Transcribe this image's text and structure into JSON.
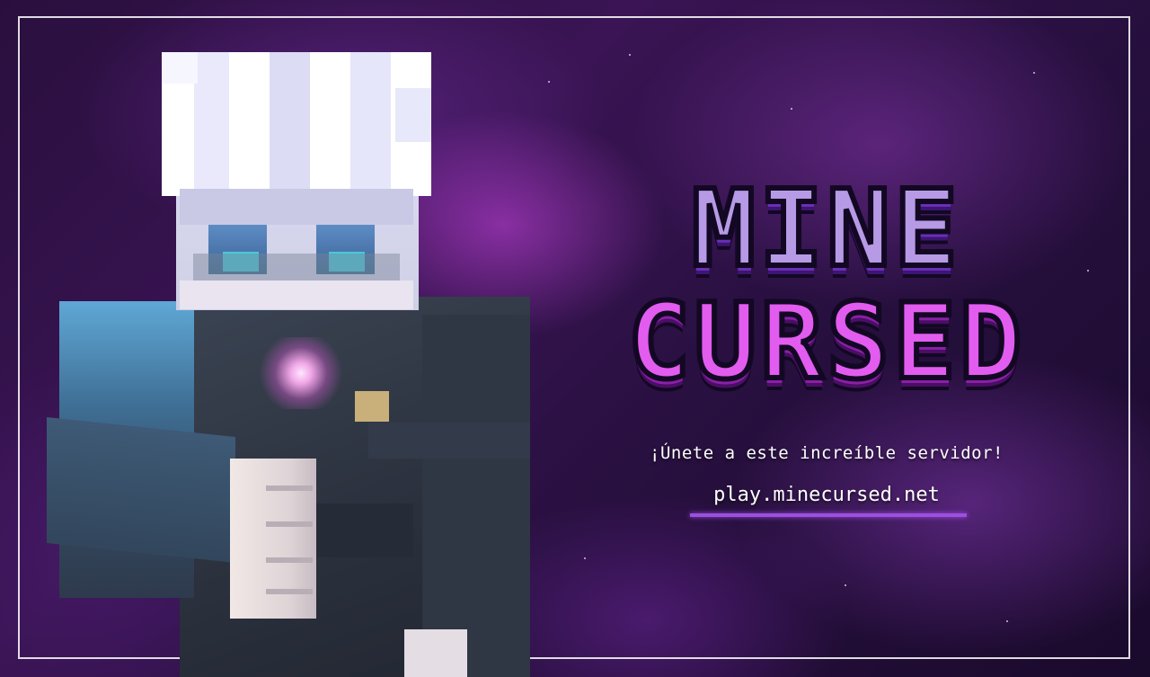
{
  "banner": {
    "logo": {
      "line1": "MINE",
      "line2": "CURSED"
    },
    "tagline": "¡Únete a este increíble servidor!",
    "server_ip": "play.minecursed.net"
  },
  "colors": {
    "background": "#2a0f3e",
    "logo_top": "#b79ae6",
    "logo_bottom": "#e25cf0",
    "accent_underline": "#9d4fe0",
    "frame": "#ffffff"
  }
}
